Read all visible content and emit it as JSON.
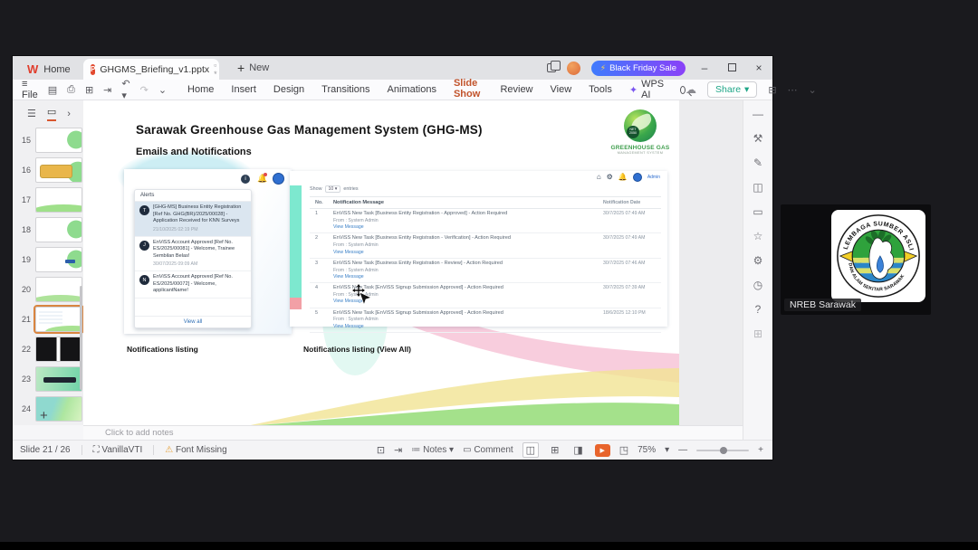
{
  "meeting": {
    "participant_name": "NREB Sarawak"
  },
  "window_tabs": {
    "home": "Home",
    "document": "GHGMS_Briefing_v1.pptx",
    "new_label": "New",
    "promo": "Black Friday Sale"
  },
  "toolbar": {
    "file": "File",
    "menus": [
      "Home",
      "Insert",
      "Design",
      "Transitions",
      "Animations",
      "Slide Show",
      "Review",
      "View",
      "Tools"
    ],
    "active_menu": "Slide Show",
    "ai_label": "WPS AI",
    "share_label": "Share"
  },
  "slide_panel": {
    "numbers": [
      "15",
      "16",
      "17",
      "18",
      "19",
      "20",
      "21",
      "22",
      "23",
      "24"
    ],
    "add_label": "+"
  },
  "slide": {
    "title": "Sarawak Greenhouse Gas Management System (GHG-MS)",
    "subtitle": "Emails and Notifications",
    "logo": {
      "line1": "GREENHOUSE GAS",
      "line2": "MANAGEMENT SYSTEM",
      "badge_top": "NET",
      "badge_bottom": "2050"
    },
    "captions": {
      "left": "Notifications listing",
      "right": "Notifications listing (View All)"
    },
    "alerts": {
      "title": "Alerts",
      "items": [
        {
          "initial": "T",
          "text": "[GHG-MS] Business Entity Registration [Ref No. GHG(BR)/2025/00028] - Application Received for KNN Surveys",
          "date": "21/10/2025 02:19 PM"
        },
        {
          "initial": "J",
          "text": "EnViSS Account Approved [Ref No. ES/2025/00081] - Welcome, Trainee Sembilan Belas!",
          "date": "30/07/2025 09:09 AM"
        },
        {
          "initial": "N",
          "text": "EnViSS Account Approved [Ref No. ES/2025/00072] - Welcome, applicantName!"
        }
      ],
      "view_all": "View all"
    },
    "portal": {
      "admin": "Admin",
      "show_label": "Show",
      "show_value": "10",
      "entries_label": "entries",
      "headers": {
        "no": "No.",
        "message": "Notification Message",
        "date": "Notification Date"
      },
      "rows": [
        {
          "no": "1",
          "message": "EnViSS New Task [Business Entity Registration - Approved] - Action Required",
          "from": "From : System Admin",
          "link": "View Message",
          "date": "30/7/2025 07:49 AM"
        },
        {
          "no": "2",
          "message": "EnViSS New Task [Business Entity Registration - Verification] - Action Required",
          "from": "From : System Admin",
          "link": "View Message",
          "date": "30/7/2025 07:49 AM"
        },
        {
          "no": "3",
          "message": "EnViSS New Task [Business Entity Registration - Review] - Action Required",
          "from": "From : System Admin",
          "link": "View Message",
          "date": "30/7/2025 07:46 AM"
        },
        {
          "no": "4",
          "message": "EnViSS New Task [EnViSS Signup Submission Approved] - Action Required",
          "from": "From : System Admin",
          "link": "View Message",
          "date": "30/7/2025 07:39 AM"
        },
        {
          "no": "5",
          "message": "EnViSS New Task [EnViSS Signup Submission Approved] - Action Required",
          "from": "From : System Admin",
          "link": "View Message",
          "date": "18/6/2025 12:10 PM"
        }
      ]
    }
  },
  "notes": {
    "placeholder": "Click to add notes"
  },
  "statusbar": {
    "slide_indicator": "Slide 21 / 26",
    "theme": "VanillaVTI",
    "font_missing": "Font Missing",
    "notes_label": "Notes",
    "comment_label": "Comment",
    "zoom": "75%"
  },
  "badge_logo": {
    "top": "LEMBAGA SUMBER ASLI",
    "bottom": "DAN ALAM SEKITAR SARAWAK"
  },
  "colors": {
    "accent_orange": "#d8572f",
    "promo_start": "#3f7bfd",
    "promo_end": "#8a41f8",
    "share_teal": "#1ea587",
    "teal_strip": "#7de8cf",
    "link_blue": "#3d82c8",
    "highlight_row": "#dbe6f0"
  }
}
